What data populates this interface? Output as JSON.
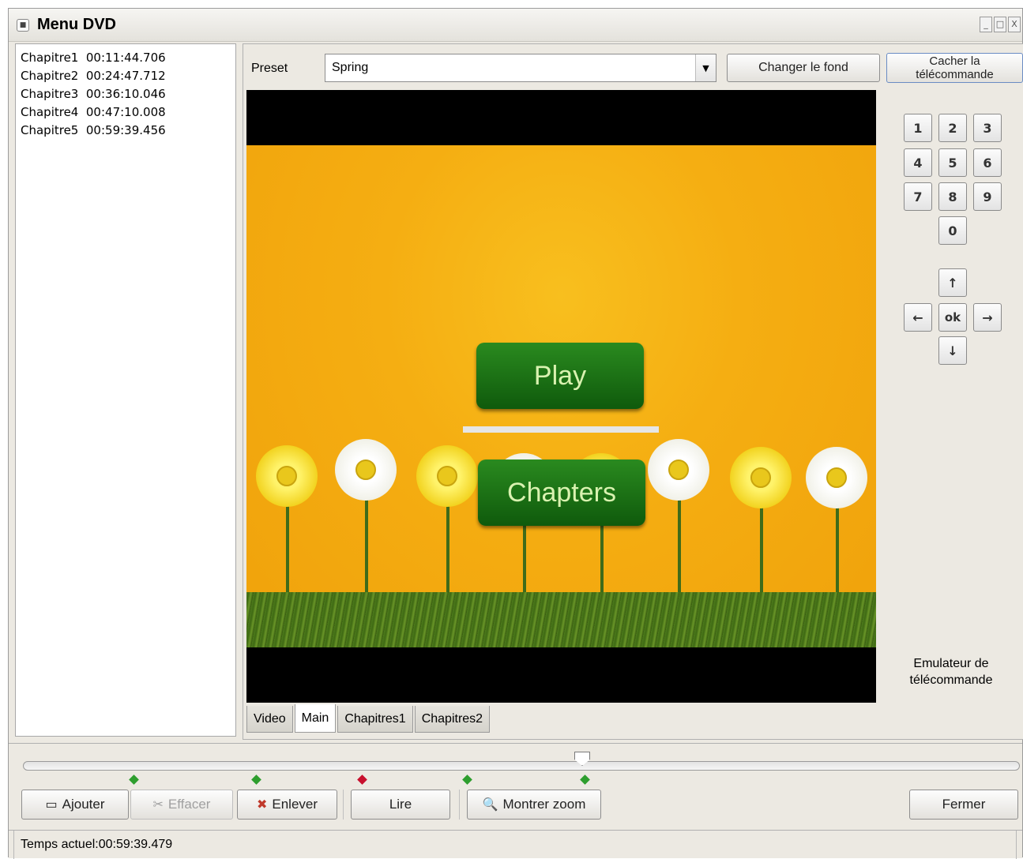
{
  "window": {
    "title": "Menu DVD",
    "controls": [
      "_",
      "□",
      "X"
    ]
  },
  "chapters": [
    "Chapitre1  00:11:44.706",
    "Chapitre2  00:24:47.712",
    "Chapitre3  00:36:10.046",
    "Chapitre4  00:47:10.008",
    "Chapitre5  00:59:39.456"
  ],
  "preset": {
    "label": "Preset",
    "value": "Spring",
    "arrow": "▼"
  },
  "buttons": {
    "changer_fond": "Changer le fond",
    "cacher_line1": "Cacher la",
    "cacher_line2": "télécommande"
  },
  "preview": {
    "play_label": "Play",
    "chapters_label": "Chapters",
    "colors": {
      "background": "#f5ae12",
      "menu_button": "#1a6e14",
      "menu_text": "#d9f2b0"
    }
  },
  "remote": {
    "digits": [
      "1",
      "2",
      "3",
      "4",
      "5",
      "6",
      "7",
      "8",
      "9",
      "0"
    ],
    "up": "↑",
    "left": "←",
    "ok": "ok",
    "right": "→",
    "down": "↓",
    "caption_line1": "Emulateur de",
    "caption_line2": "télécommande"
  },
  "tabs": [
    {
      "label": "Video",
      "active": false
    },
    {
      "label": "Main",
      "active": true
    },
    {
      "label": "Chapitres1",
      "active": false
    },
    {
      "label": "Chapitres2",
      "active": false
    }
  ],
  "timeline": {
    "marker_colors": [
      "#2e9e2e",
      "#2e9e2e",
      "#c8102e",
      "#2e9e2e",
      "#2e9e2e"
    ]
  },
  "toolbar": {
    "ajouter": "Ajouter",
    "effacer": "Effacer",
    "enlever": "Enlever",
    "lire": "Lire",
    "montrer_zoom": "Montrer zoom",
    "fermer": "Fermer"
  },
  "status": {
    "text": "Temps actuel:00:59:39.479"
  }
}
